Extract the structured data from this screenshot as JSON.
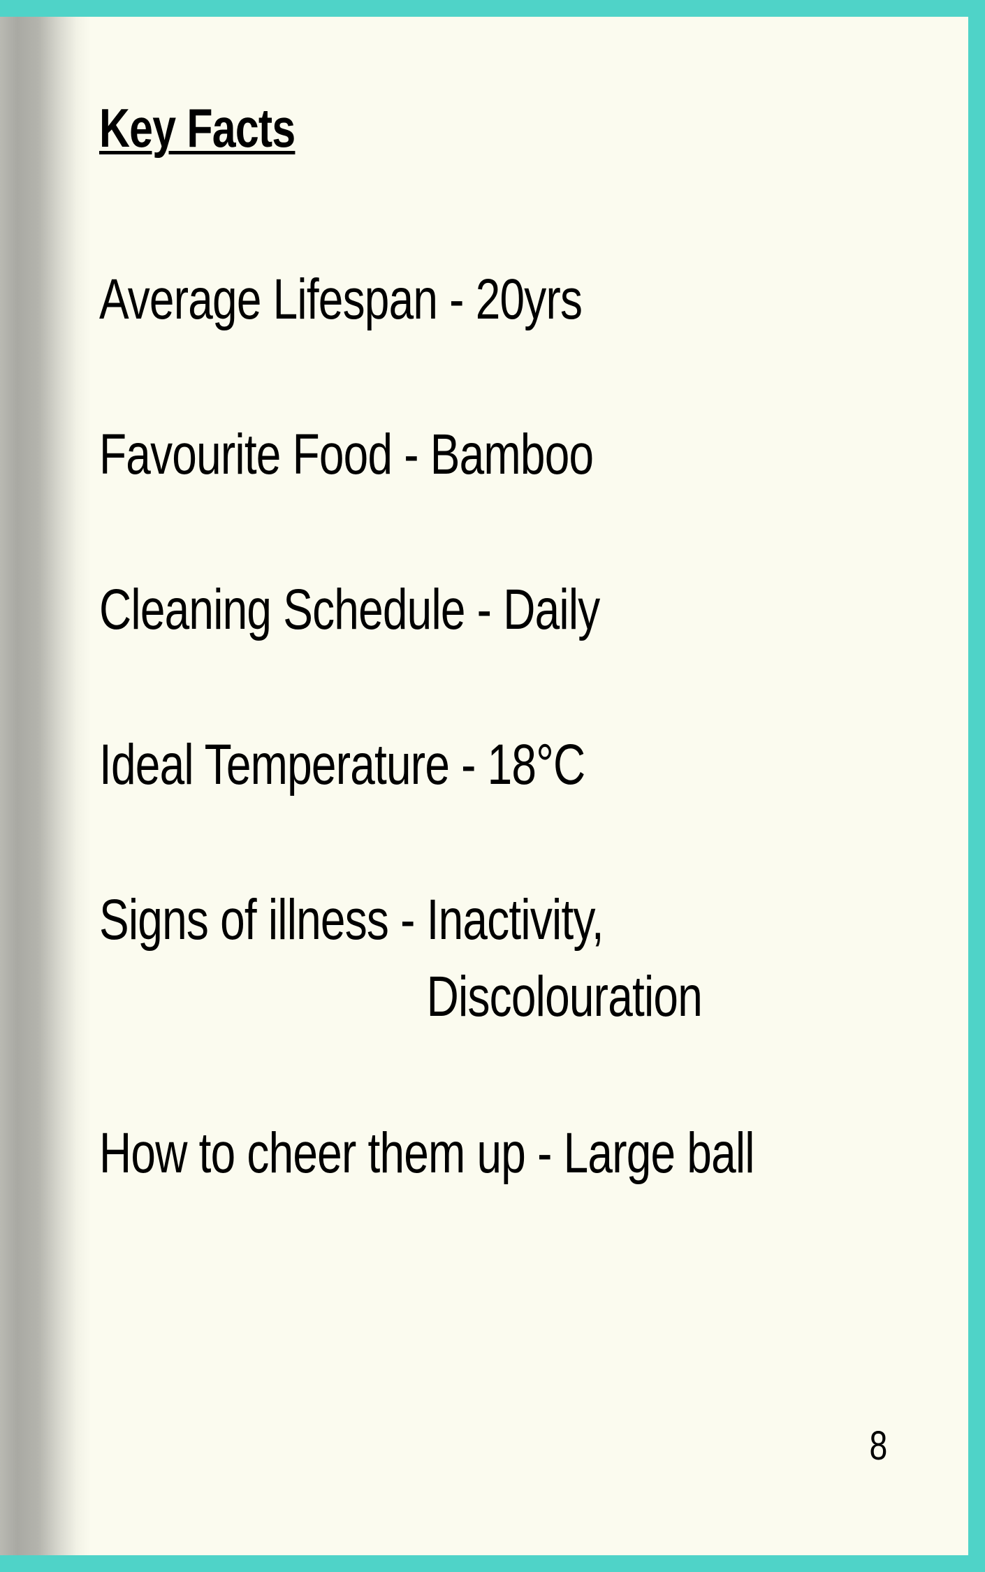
{
  "page": {
    "title": "Key Facts",
    "facts": [
      {
        "label": "Average Lifespan",
        "separator": " - ",
        "value": "20yrs"
      },
      {
        "label": "Favourite Food",
        "separator": " - ",
        "value": "Bamboo"
      },
      {
        "label": "Cleaning Schedule",
        "separator": " - ",
        "value": "Daily"
      },
      {
        "label": "Ideal Temperature",
        "separator": " - ",
        "value": "18°C"
      },
      {
        "label": "Signs of illness",
        "separator": " - ",
        "value_line1": "Inactivity,",
        "value_line2": "Discolouration"
      },
      {
        "label": "How to cheer them up",
        "separator": " - ",
        "value": "Large ball"
      }
    ],
    "page_number": "8"
  },
  "colors": {
    "border": "#4fd3c8",
    "paper": "#fbfbef",
    "text": "#000000"
  }
}
